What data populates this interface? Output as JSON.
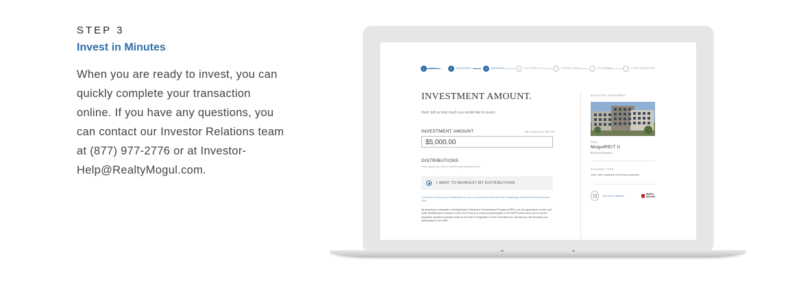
{
  "left": {
    "step": "STEP 3",
    "subtitle": "Invest in Minutes",
    "body": "When you are ready to invest, you can\nquickly complete your transaction\nonline. If you have any questions, you\ncan contact our Investor Relations team\nat (877) 977-2776 or at Investor-\nHelp@RealtyMogul.com."
  },
  "progress": [
    {
      "label": "INFO",
      "num": "1",
      "state": "done"
    },
    {
      "label": "ACCOUNT",
      "num": "2",
      "state": "done"
    },
    {
      "label": "AMOUNT",
      "num": "3",
      "state": "active"
    },
    {
      "label": "SUITABILITY",
      "num": "4",
      "state": "todo"
    },
    {
      "label": "SIGNATURE",
      "num": "5",
      "state": "todo"
    },
    {
      "label": "PAYMENT",
      "num": "6",
      "state": "todo"
    },
    {
      "label": "CONFIRMATION",
      "num": "7",
      "state": "todo"
    }
  ],
  "form": {
    "title": "INVESTMENT AMOUNT.",
    "intro": "Next, tell us how much you would like to invest.",
    "amount_label": "INVESTMENT AMOUNT",
    "amount_min": "Min Investment: $50,000",
    "amount_value": "$5,000.00",
    "dist_label": "DISTRIBUTIONS",
    "dist_help": "How would you like to receive your distributions?",
    "radio_label": "I WANT TO REINVEST MY DISTRIBUTIONS",
    "drip_text": "Choose to reinvest your distributions to are a compound benefit with the RealtyMogul Distribution Reinvestment Plan.",
    "legal_text": "By selecting to participate in RealtyMogul's Distribution Reinvestment Program (DRIP), you are agreeing to monitor and notify RealtyMogul in advance of the event that your continued participation in the DRIP would cause you to exceed applicable qualified purchaser limits as set forth in Regulation A of the Securities Act, and that you will terminate your participation in the DRIP."
  },
  "sidebar": {
    "heading": "SELECTED INVESTMENT",
    "tag": "Equity",
    "name": "MogulREIT II",
    "min": "$5,000.00 Minimum",
    "account_heading": "ACCOUNT TYPE",
    "account_value": "Joint: John Anderson and Vivian Anderson",
    "secure_prefix": "This Site is ",
    "secure_link": "Secure",
    "mcafee_line1": "McAfee",
    "mcafee_line2": "SECURE"
  },
  "colors": {
    "accent": "#2f6fa8",
    "laptop_frame": "#e6e6e6"
  }
}
